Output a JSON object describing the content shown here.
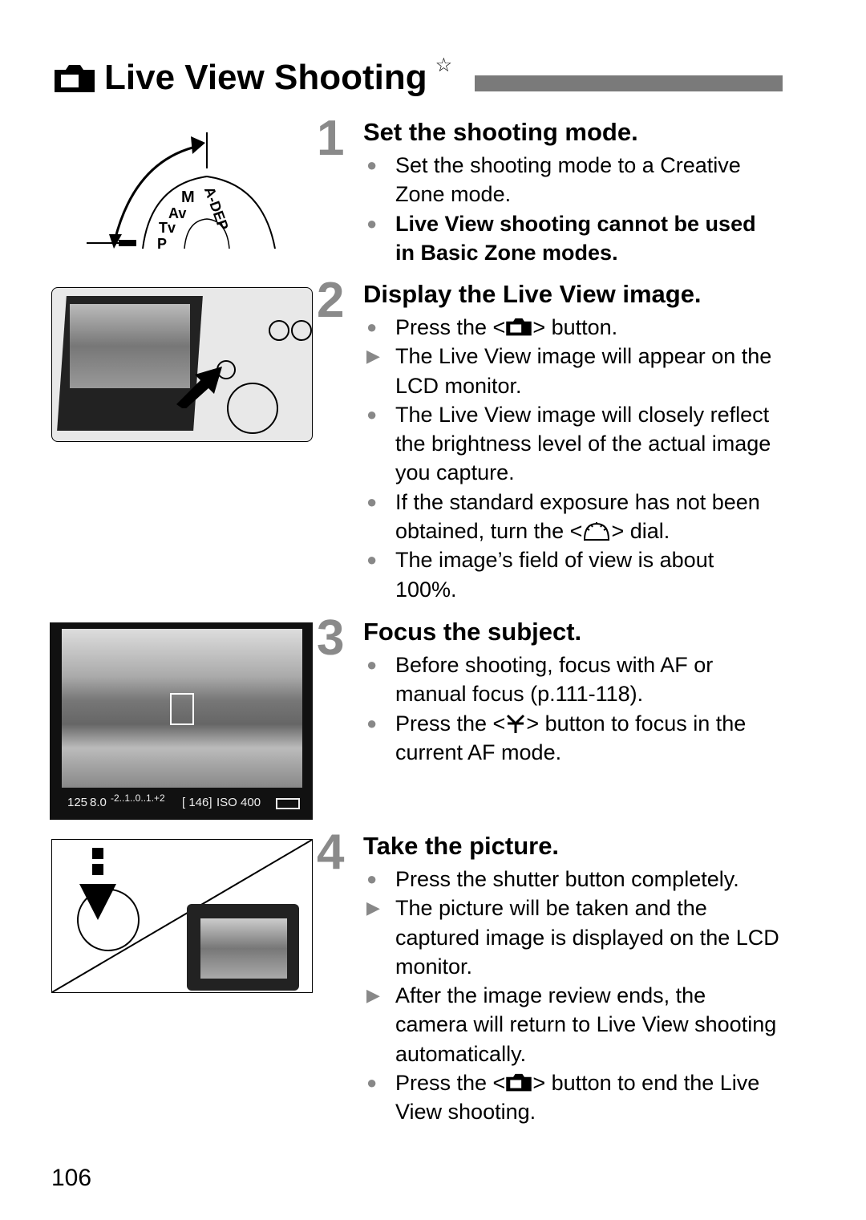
{
  "title": "Live View Shooting",
  "title_icon": "live-view-camera-icon",
  "title_mark": "☆",
  "steps": [
    {
      "number": "1",
      "heading": "Set the shooting mode.",
      "items": [
        {
          "type": "bullet",
          "text": "Set the shooting mode to a Creative Zone mode."
        },
        {
          "type": "bullet",
          "bold": true,
          "text": "Live View shooting cannot be used in Basic Zone modes."
        }
      ]
    },
    {
      "number": "2",
      "heading": "Display the Live View image.",
      "items": [
        {
          "type": "bullet",
          "pre": "Press the <",
          "icon": "live-view-camera-icon",
          "post": "> button."
        },
        {
          "type": "result",
          "text": "The Live View image will appear on the LCD monitor."
        },
        {
          "type": "bullet",
          "text": "The Live View image will closely reflect the brightness level of the actual image you capture."
        },
        {
          "type": "bullet",
          "pre": "If the standard exposure has not been obtained, turn the <",
          "icon": "main-dial-icon",
          "post": "> dial."
        },
        {
          "type": "bullet",
          "text": "The image’s field of view is about 100%."
        }
      ]
    },
    {
      "number": "3",
      "heading": "Focus the subject.",
      "items": [
        {
          "type": "bullet",
          "text": "Before shooting, focus with AF or manual focus (p.111-118)."
        },
        {
          "type": "bullet",
          "pre": "Press the <",
          "icon": "af-start-icon",
          "post": "> button to focus in the current AF mode."
        }
      ]
    },
    {
      "number": "4",
      "heading": "Take the picture.",
      "items": [
        {
          "type": "bullet",
          "text": "Press the shutter button completely."
        },
        {
          "type": "result",
          "text": "The picture will be taken and the captured image is displayed on the LCD monitor."
        },
        {
          "type": "result",
          "text": "After the image review ends, the camera will return to Live View shooting automatically."
        },
        {
          "type": "bullet",
          "pre": "Press the <",
          "icon": "live-view-camera-icon",
          "post": "> button to end the Live View shooting."
        }
      ]
    }
  ],
  "figures": {
    "dial_labels": [
      "A-DEP",
      "M",
      "Av",
      "Tv",
      "P"
    ],
    "lcd": {
      "shutter": "125",
      "aperture": "8.0",
      "scale": "-2..1..0..1.+2",
      "shots": "[ 146]",
      "iso": "ISO 400"
    }
  },
  "page_number": "106"
}
